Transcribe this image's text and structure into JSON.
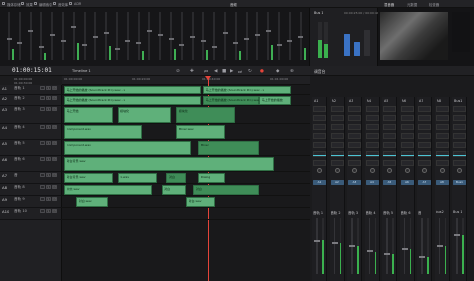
{
  "app": {
    "title": "音频",
    "menu": [
      "媒体存储",
      "效果",
      "编辑索引",
      "音效库",
      "ADR"
    ],
    "right_menu": [
      "混音器",
      "元数据",
      "检查器"
    ],
    "bus_label": "Bus 1",
    "clip_info": "00:00:25:00 / 00:00:44:10"
  },
  "timeline": {
    "timecode": "01:00:15:01",
    "name": "Timeline 1",
    "ruler": [
      "01:00:00:00",
      "01:00:20:00",
      "01:00:40:00",
      "01:01:00:00"
    ],
    "start_tc": "01:00:00:00",
    "mid_tc": "01:00:30:00"
  },
  "tracks": [
    {
      "id": "A1",
      "label": "音轨 1",
      "vol": "2.0"
    },
    {
      "id": "A2",
      "label": "音轨 2",
      "vol": "2.0"
    },
    {
      "id": "A3",
      "label": "音轨 3",
      "vol": "2.0"
    },
    {
      "id": "A4",
      "label": "音轨 4",
      "vol": "2.0"
    },
    {
      "id": "A5",
      "label": "音轨 5",
      "vol": "2.0"
    },
    {
      "id": "A6",
      "label": "音轨 6",
      "vol": "2.0"
    },
    {
      "id": "A7",
      "label": "音",
      "vol": "2.0"
    },
    {
      "id": "A8",
      "label": "音轨 8",
      "vol": "2.0"
    },
    {
      "id": "A9",
      "label": "音轨 9",
      "vol": "2.0"
    },
    {
      "id": "A10",
      "label": "音轨 10",
      "vol": "2.0"
    }
  ],
  "clips": [
    {
      "label": "马上开始的播放 (Soundtrack Pro).wav - L",
      "lane": 0,
      "start": 0.0,
      "end": 0.56
    },
    {
      "label": "马上开始的播放 (Soundtrack Pro).wav - L",
      "lane": 0,
      "start": 0.57,
      "end": 0.93
    },
    {
      "label": "马上开始的播放 (Soundtrack Pro).wav - L",
      "lane": 1,
      "start": 0.0,
      "end": 0.56
    },
    {
      "label": "马上开始的播放 (Soundtrack Pro).wav - R",
      "lane": 1,
      "start": 0.57,
      "end": 0.8
    },
    {
      "label": "马上开始的播放",
      "lane": 1,
      "start": 0.8,
      "end": 0.93
    },
    {
      "label": "马上开始",
      "lane": 2,
      "start": 0.0,
      "end": 0.2
    },
    {
      "label": "模块化",
      "lane": 2,
      "start": 0.22,
      "end": 0.44
    },
    {
      "label": "模块化",
      "lane": 2,
      "start": 0.46,
      "end": 0.7
    },
    {
      "label": "Component.wav",
      "lane": 3,
      "start": 0.0,
      "end": 0.32
    },
    {
      "label": "Mixer.wav",
      "lane": 3,
      "start": 0.46,
      "end": 0.66
    },
    {
      "label": "Component.wav",
      "lane": 4,
      "start": 0.0,
      "end": 0.52
    },
    {
      "label": "Mixer",
      "lane": 4,
      "start": 0.55,
      "end": 0.8
    },
    {
      "label": "对白背景.wav",
      "lane": 5,
      "start": 0.0,
      "end": 0.86
    },
    {
      "label": "对白背景.wav",
      "lane": 6,
      "start": 0.0,
      "end": 0.2
    },
    {
      "label": "1.wav",
      "lane": 6,
      "start": 0.22,
      "end": 0.38
    },
    {
      "label": "对白",
      "lane": 6,
      "start": 0.42,
      "end": 0.5
    },
    {
      "label": "Dialog",
      "lane": 6,
      "start": 0.55,
      "end": 0.66
    },
    {
      "label": "中文.wav",
      "lane": 7,
      "start": 0.0,
      "end": 0.36
    },
    {
      "label": "对白",
      "lane": 7,
      "start": 0.4,
      "end": 0.5
    },
    {
      "label": "对白",
      "lane": 7,
      "start": 0.53,
      "end": 0.8
    },
    {
      "label": "对白.wav",
      "lane": 8,
      "start": 0.05,
      "end": 0.18
    },
    {
      "label": "对白.wav",
      "lane": 8,
      "start": 0.5,
      "end": 0.62
    }
  ],
  "mixer": {
    "title": "调音台",
    "channels": [
      "A1",
      "A2",
      "A3",
      "A4",
      "A5",
      "A6",
      "A7",
      "A8",
      "Bus1"
    ],
    "names": [
      "音轨 1",
      "音轨 2",
      "音轨 3",
      "音轨 4",
      "音轨 5",
      "音轨 6",
      "音",
      "bus2",
      "Bus 1"
    ],
    "rows": [
      "输入",
      "效果",
      "插件",
      "EQ",
      "动态",
      "声像",
      "总线"
    ],
    "levels": [
      0.6,
      0.55,
      0.5,
      0.4,
      0.35,
      0.45,
      0.3,
      0.5,
      0.7
    ]
  },
  "colors": {
    "clip": "#5fb07a",
    "playhead": "#e5443a",
    "meter": "#3bb04e",
    "eq": "#4cc4d4"
  }
}
